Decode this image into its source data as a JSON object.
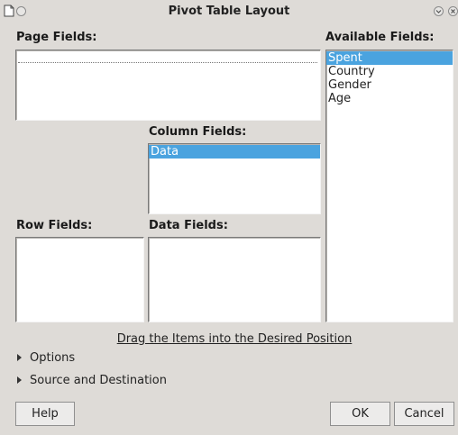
{
  "window": {
    "title": "Pivot Table Layout"
  },
  "page_fields": {
    "label": "Page Fields:",
    "items": []
  },
  "available_fields": {
    "label": "Available Fields:",
    "items": [
      "Spent",
      "Country",
      "Gender",
      "Age"
    ],
    "selected": "Spent"
  },
  "column_fields": {
    "label": "Column Fields:",
    "items": [
      "Data"
    ],
    "selected": "Data"
  },
  "row_fields": {
    "label": "Row Fields:",
    "items": []
  },
  "data_fields": {
    "label": "Data Fields:",
    "items": []
  },
  "hint": "Drag the Items into the Desired Position",
  "expanders": {
    "options": "Options",
    "source": "Source and Destination"
  },
  "buttons": {
    "help": "Help",
    "ok": "OK",
    "cancel": "Cancel"
  },
  "colors": {
    "selection": "#4aa3df",
    "background": "#dedbd7"
  }
}
